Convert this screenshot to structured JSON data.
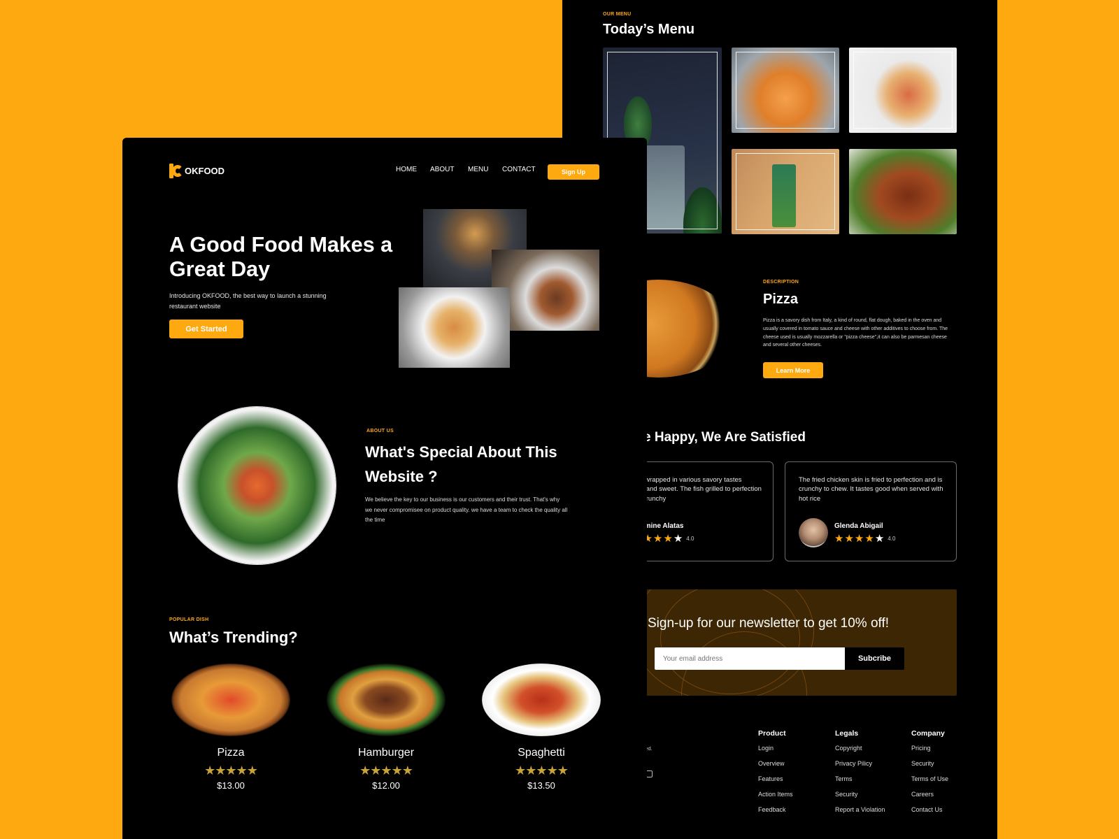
{
  "colors": {
    "background": "#FFA910",
    "accent": "#FFA910",
    "page": "#000000",
    "star_gold": "#C9A338"
  },
  "back": {
    "menu_eyebrow": "OUR MENU",
    "menu_title": "Today’s Menu",
    "description": {
      "eyebrow": "DESCRIPTION",
      "title": "Pizza",
      "text": "Pizza is a savory dish from Italy, a kind of round, flat dough, baked in the oven and usually covered in tomato sauce and cheese with other additives to choose from. The cheese used is usually mozzarella or \"pizza cheese\",it can also be parmesan cheese and several other cheeses.",
      "button": "Learn More"
    },
    "testimonials": {
      "title": "e Happy, We Are Satisfied",
      "cards": [
        {
          "quote": "d meat is wrapped in various savory tastes barbeque and sweet. The fish grilled to perfection and was crunchy",
          "name": "Jasmine Alatas",
          "rating": "4.0"
        },
        {
          "quote": "The fried chicken skin is fried to perfection and is crunchy to chew. It tastes good when served with hot rice",
          "name": "Glenda Abigail",
          "rating": "4.0"
        }
      ]
    },
    "newsletter": {
      "title": "Sign-up for our newsletter to get 10% off!",
      "placeholder": "Your email address",
      "button": "Subcribe"
    },
    "footer": {
      "reserved": "eserved.",
      "product": {
        "head": "Product",
        "links": [
          "Login",
          "Overview",
          "Features",
          "Action Items",
          "Feedback"
        ]
      },
      "legals": {
        "head": "Legals",
        "links": [
          "Copyright",
          "Privacy Pilicy",
          "Terms",
          "Security",
          "Report a Violation"
        ]
      },
      "company": {
        "head": "Company",
        "links": [
          "Pricing",
          "Security",
          "Terms of Use",
          "Careers",
          "Contact Us"
        ]
      }
    }
  },
  "front": {
    "logo_text": "OKFOOD",
    "nav": [
      "HOME",
      "ABOUT",
      "MENU",
      "CONTACT"
    ],
    "signup": "Sign Up",
    "hero": {
      "title": "A Good Food Makes a Great Day",
      "subtitle": "Introducing OKFOOD, the best way to launch a stunning restaurant website",
      "button": "Get Started"
    },
    "about": {
      "eyebrow": "ABOUT US",
      "title": "What's Special About This Website ?",
      "text": "We believe the key to our business is our customers and their trust.  That's why we never compromisee on product quality.  we have a team to check the quality all the time"
    },
    "popular": {
      "eyebrow": "POPULAR DISH",
      "title": "What’s Trending?",
      "dishes": [
        {
          "name": "Pizza",
          "rating": 5,
          "price": "$13.00"
        },
        {
          "name": "Hamburger",
          "rating": 5,
          "price": "$12.00"
        },
        {
          "name": "Spaghetti",
          "rating": 5,
          "price": "$13.50"
        }
      ]
    }
  }
}
